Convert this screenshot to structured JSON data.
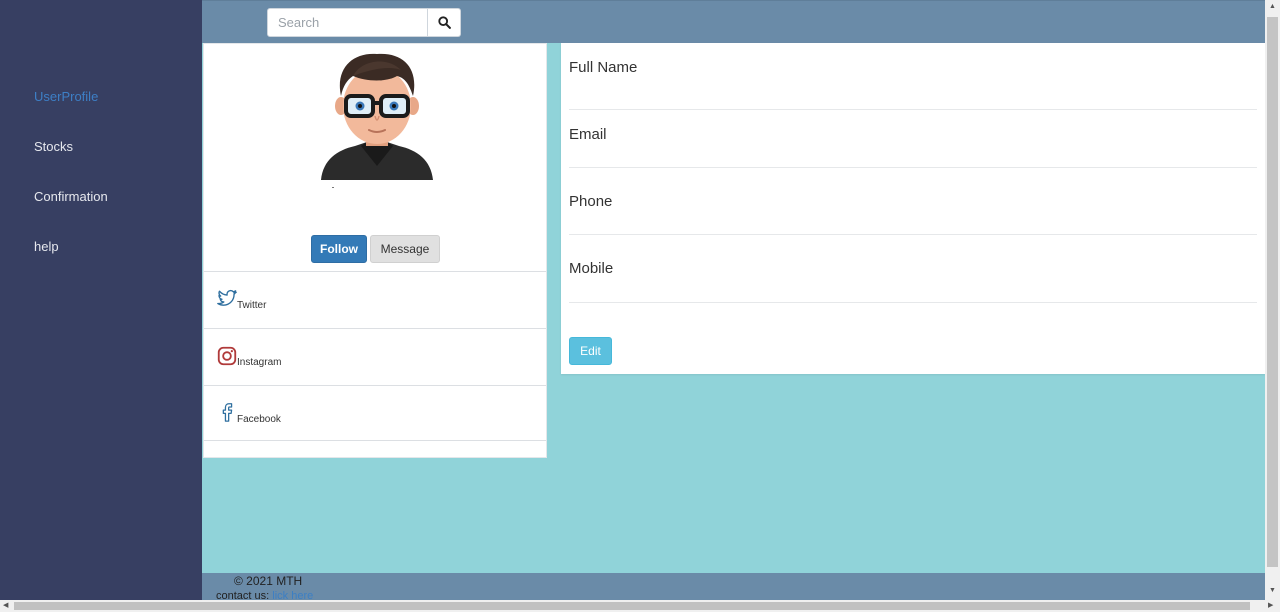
{
  "sidebar": {
    "items": [
      {
        "label": "UserProfile",
        "active": true
      },
      {
        "label": "Stocks",
        "active": false
      },
      {
        "label": "Confirmation",
        "active": false
      },
      {
        "label": "help",
        "active": false
      }
    ]
  },
  "header": {
    "search": {
      "placeholder": "Search",
      "icon": "search-icon"
    }
  },
  "profile": {
    "avatar_icon": "user-avatar",
    "actions": {
      "follow_label": "Follow",
      "message_label": "Message"
    },
    "social": [
      {
        "label": "Twitter",
        "icon": "twitter-icon"
      },
      {
        "label": "Instagram",
        "icon": "instagram-icon"
      },
      {
        "label": "Facebook",
        "icon": "facebook-icon"
      }
    ]
  },
  "details": {
    "fields": [
      {
        "label": "Full Name",
        "value": ""
      },
      {
        "label": "Email",
        "value": ""
      },
      {
        "label": "Phone",
        "value": ""
      },
      {
        "label": "Mobile",
        "value": ""
      }
    ],
    "edit_label": "Edit"
  },
  "footer": {
    "copyright": "© 2021 MTH",
    "contact_prefix": "contact us: ",
    "contact_link": "lick here"
  },
  "colors": {
    "sidebar_bg": "#373f62",
    "topbar_bg": "#6a8ba8",
    "page_bg": "#90d3d9",
    "active_link": "#3d7fc6",
    "follow_button": "#337ab7",
    "edit_button": "#5bc0de"
  }
}
